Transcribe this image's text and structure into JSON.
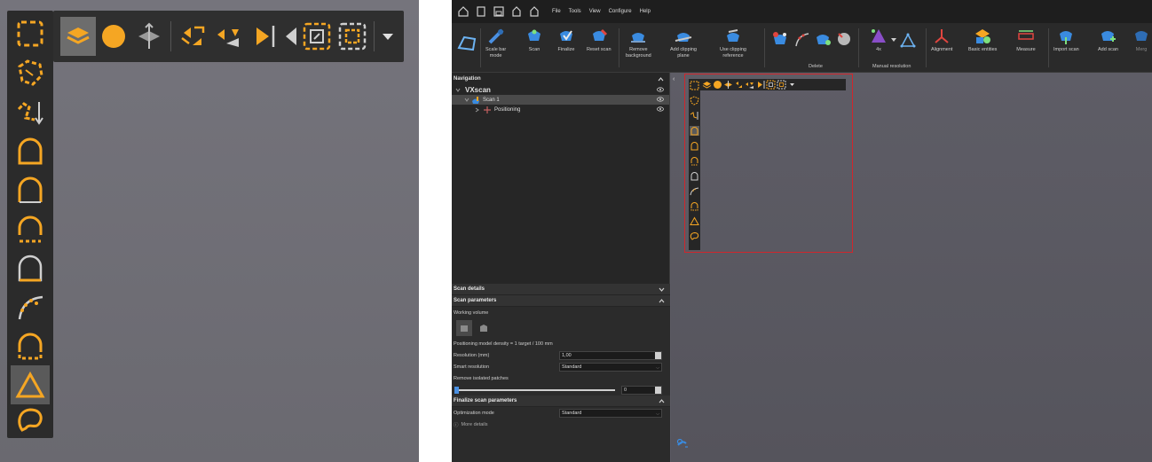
{
  "left_panel": {
    "vertical_toolbar": [
      {
        "icon": "select-rectangle-icon"
      },
      {
        "icon": "select-freeform-icon"
      },
      {
        "icon": "select-polyline-icon"
      },
      {
        "icon": "shape-arch-icon"
      },
      {
        "icon": "shape-arch-double-icon"
      },
      {
        "icon": "shape-arch-dashed-icon"
      },
      {
        "icon": "shape-arch-gray-icon"
      },
      {
        "icon": "curve-points-icon"
      },
      {
        "icon": "shape-dashed-arch-icon"
      },
      {
        "icon": "triangle-icon",
        "active": true
      },
      {
        "icon": "lasso-icon"
      }
    ],
    "horizontal_toolbar": [
      {
        "icon": "layers-icon",
        "active": true
      },
      {
        "icon": "sphere-icon"
      },
      {
        "icon": "plane-split-icon"
      },
      {
        "icon": "grow-selection-icon"
      },
      {
        "icon": "shrink-selection-icon"
      },
      {
        "icon": "expand-right-icon"
      },
      {
        "icon": "expand-region-icon"
      },
      {
        "icon": "shrink-region-icon"
      },
      {
        "icon": "dropdown-icon"
      }
    ]
  },
  "app": {
    "menu": [
      "File",
      "Tools",
      "View",
      "Configure",
      "Help"
    ],
    "ribbon": [
      {
        "label": "Scale bar\nmode",
        "icon": "scale-bar-icon"
      },
      {
        "label": "Scan",
        "icon": "scan-icon"
      },
      {
        "label": "Finalize",
        "icon": "finalize-icon"
      },
      {
        "label": "Reset scan",
        "icon": "reset-scan-icon"
      },
      {
        "label": "Remove\nbackground",
        "icon": "remove-background-icon"
      },
      {
        "label": "Add clipping\nplane",
        "icon": "clipping-plane-icon"
      },
      {
        "label": "Use clipping\nreference",
        "icon": "clipping-reference-icon"
      },
      {
        "label": "4x",
        "icon": "resolution-4x-icon"
      },
      {
        "label": "Alignment",
        "icon": "alignment-icon"
      },
      {
        "label": "Basic entities",
        "icon": "basic-entities-icon"
      },
      {
        "label": "Measure",
        "icon": "measure-icon"
      },
      {
        "label": "Import scan",
        "icon": "import-scan-icon"
      },
      {
        "label": "Add scan",
        "icon": "add-scan-icon"
      },
      {
        "label": "Merg",
        "icon": "merge-icon"
      }
    ],
    "ribbon_groups": {
      "delete": "Delete",
      "manual_resolution": "Manual resolution"
    },
    "navigation": {
      "title": "Navigation",
      "root": "VXscan",
      "scan": "Scan 1",
      "child": "Positioning"
    },
    "scan_details": {
      "title": "Scan details",
      "params_title": "Scan parameters",
      "working_volume": "Working volume",
      "density": "Positioning model density = 1 target / 100 mm",
      "resolution_label": "Resolution (mm)",
      "resolution_value": "1,00",
      "smart_label": "Smart resolution",
      "smart_value": "Standard",
      "isolated_label": "Remove isolated patches",
      "isolated_value": "0",
      "finalize_title": "Finalize scan parameters",
      "optimization_label": "Optimization mode",
      "optimization_value": "Standard",
      "more_details": "More details"
    }
  },
  "colors": {
    "accent": "#f5a623",
    "highlight": "#d0262c",
    "panel": "#2b2b2b"
  }
}
